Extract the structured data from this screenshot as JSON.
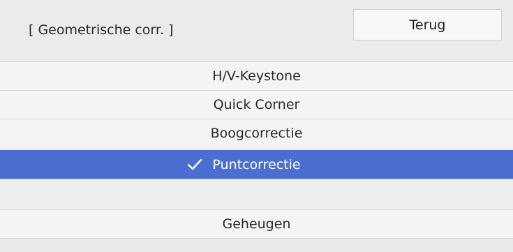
{
  "header": {
    "title": "[ Geometrische corr. ]",
    "back_label": "Terug"
  },
  "menu": {
    "items": [
      {
        "label": "H/V-Keystone",
        "selected": false
      },
      {
        "label": "Quick Corner",
        "selected": false
      },
      {
        "label": "Boogcorrectie",
        "selected": false
      },
      {
        "label": "Puntcorrectie",
        "selected": true
      },
      {
        "label": "",
        "selected": false
      },
      {
        "label": "Geheugen",
        "selected": false
      }
    ]
  },
  "icons": {
    "selected_marker": "checkmark-icon"
  },
  "colors": {
    "selection": "#4a6fd1",
    "background": "#f0f0f0",
    "header": "#ebebeb"
  }
}
